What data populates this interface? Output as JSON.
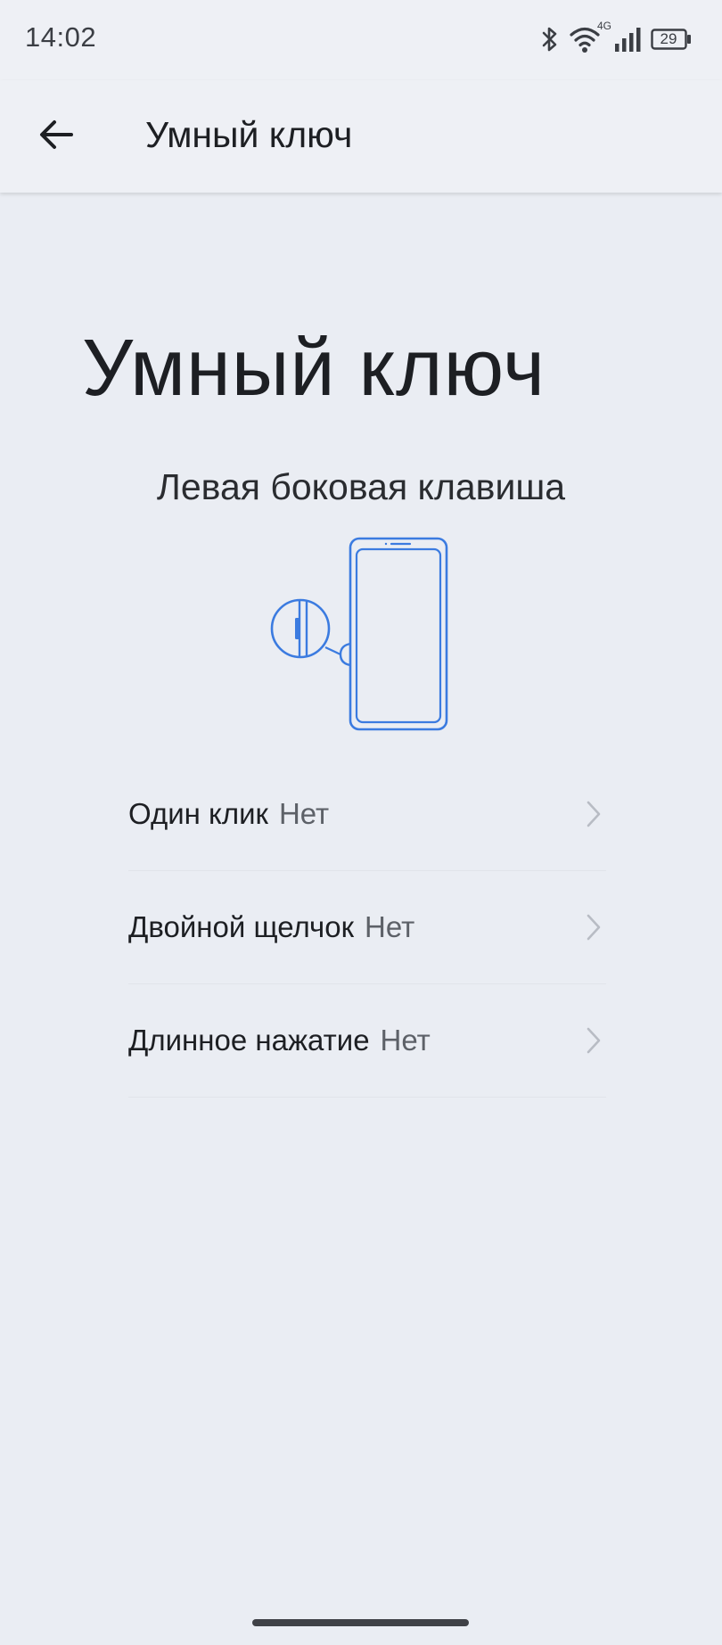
{
  "status_bar": {
    "time": "14:02",
    "network_label": "4G",
    "battery_level": "29",
    "icons": [
      "bluetooth-icon",
      "wifi-icon",
      "signal-icon",
      "battery-icon"
    ]
  },
  "app_bar": {
    "title": "Умный ключ",
    "back_icon": "arrow-left-icon"
  },
  "main": {
    "title": "Умный ключ",
    "subtitle": "Левая боковая клавиша",
    "illustration_icon": "phone-side-key-icon",
    "accent_color": "#3b7be0",
    "items": [
      {
        "label": "Один клик",
        "value": "Нет"
      },
      {
        "label": "Двойной щелчок",
        "value": "Нет"
      },
      {
        "label": "Длинное нажатие",
        "value": "Нет"
      }
    ]
  }
}
